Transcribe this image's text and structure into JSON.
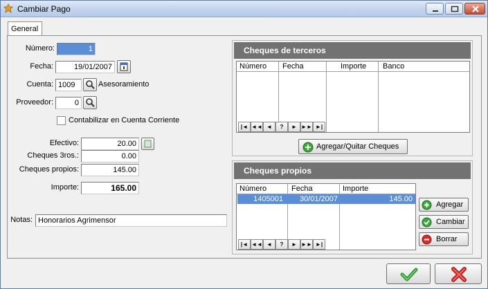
{
  "window": {
    "title": "Cambiar Pago"
  },
  "tabs": [
    "General"
  ],
  "form": {
    "numero_label": "Número:",
    "numero_value": "1",
    "fecha_label": "Fecha:",
    "fecha_value": "19/01/2007",
    "cuenta_label": "Cuenta:",
    "cuenta_value": "1009",
    "cuenta_name": "Asesoramiento",
    "proveedor_label": "Proveedor:",
    "proveedor_value": "0",
    "contabilizar_label": "Contabilizar en Cuenta Corriente",
    "contabilizar_checked": false,
    "efectivo_label": "Efectivo:",
    "efectivo_value": "20.00",
    "cheques3_label": "Cheques 3ros.:",
    "cheques3_value": "0.00",
    "chequesp_label": "Cheques propios:",
    "chequesp_value": "145.00",
    "importe_label": "Importe:",
    "importe_value": "165.00",
    "notas_label": "Notas:",
    "notas_value": "Honorarios Agrimensor"
  },
  "terceros": {
    "title": "Cheques de terceros",
    "columns": [
      "Número",
      "Fecha",
      "Importe",
      "Banco"
    ],
    "rows": [],
    "button": "Agregar/Quitar Cheques"
  },
  "propios": {
    "title": "Cheques propios",
    "columns": [
      "Número",
      "Fecha",
      "Importe"
    ],
    "rows": [
      {
        "numero": "1405001",
        "fecha": "30/01/2007",
        "importe": "145.00"
      }
    ],
    "buttons": {
      "agregar": "Agregar",
      "cambiar": "Cambiar",
      "borrar": "Borrar"
    }
  },
  "navigator": [
    "|◄",
    "◄◄",
    "◄",
    "?",
    "►",
    "►►",
    "►|"
  ],
  "colors": {
    "selection": "#5a8ed6",
    "header": "#727272",
    "ok": "#3aa83a",
    "cancel": "#d92b2b"
  }
}
